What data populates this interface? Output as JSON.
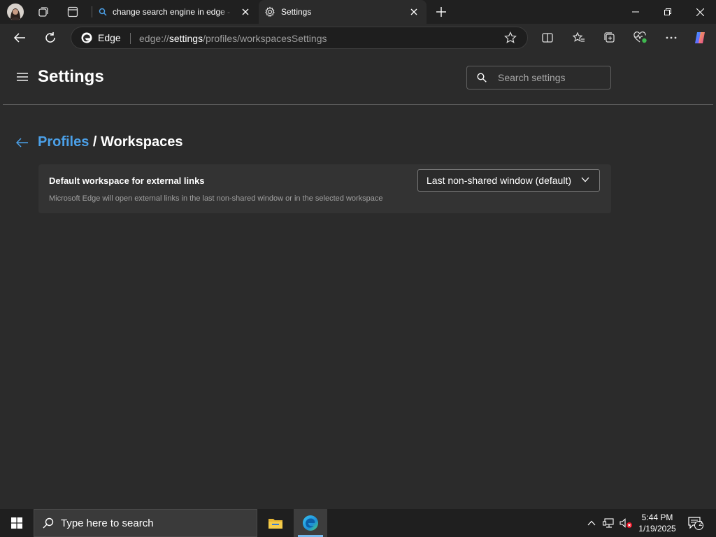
{
  "tabs": [
    {
      "title": "change search engine in edge - Search",
      "icon": "search-icon"
    },
    {
      "title": "Settings",
      "icon": "gear-icon"
    }
  ],
  "toolbar": {
    "site_label": "Edge",
    "url_scheme": "edge://",
    "url_host": "settings",
    "url_path": "/profiles/workspacesSettings"
  },
  "settings": {
    "title": "Settings",
    "search_placeholder": "Search settings",
    "breadcrumb": {
      "parent": "Profiles",
      "separator": " / ",
      "current": "Workspaces"
    },
    "card": {
      "title": "Default workspace for external links",
      "description": "Microsoft Edge will open external links in the last non-shared window or in the selected workspace",
      "select_value": "Last non-shared window (default)"
    }
  },
  "taskbar": {
    "search_placeholder": "Type here to search",
    "time": "5:44 PM",
    "date": "1/19/2025",
    "notification_count": "2"
  },
  "colors": {
    "background": "#2b2b2b",
    "tabstrip": "#202020",
    "accent_link": "#4ba0e8",
    "card": "#333333",
    "taskbar": "#1f1f1f"
  }
}
